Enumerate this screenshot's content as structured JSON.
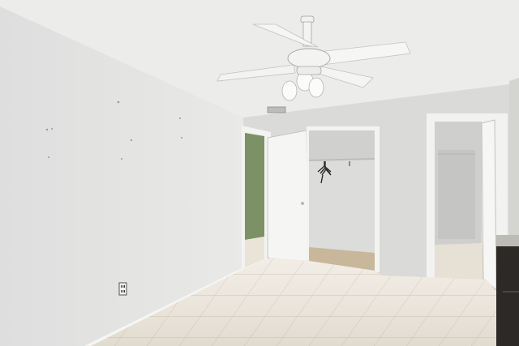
{
  "scene": {
    "description_names": [
      "textured-ceiling",
      "ceiling-fan",
      "left-wall",
      "back-wall",
      "open-door-hallway",
      "open-closet",
      "clothes-hangers",
      "bathroom-doorway",
      "tile-floor",
      "wall-outlet",
      "cabinet-edge"
    ]
  },
  "colors": {
    "ceiling": "#ededeb",
    "left_wall": "#e4e4e2",
    "back_wall": "#dcdcda",
    "right_wall": "#d6d6d3",
    "green_wall": "#7f9368",
    "floor_light": "#f1ece3",
    "floor_dark": "#ddd5c7",
    "grout": "#c9c0b1",
    "door": "#f4f4f2",
    "closet_interior": "#dededd",
    "closet_floor": "#c9b79c",
    "baseboard": "#f6f6f4",
    "fan": "#f3f3f1",
    "cabinet": "#2d2a27"
  }
}
